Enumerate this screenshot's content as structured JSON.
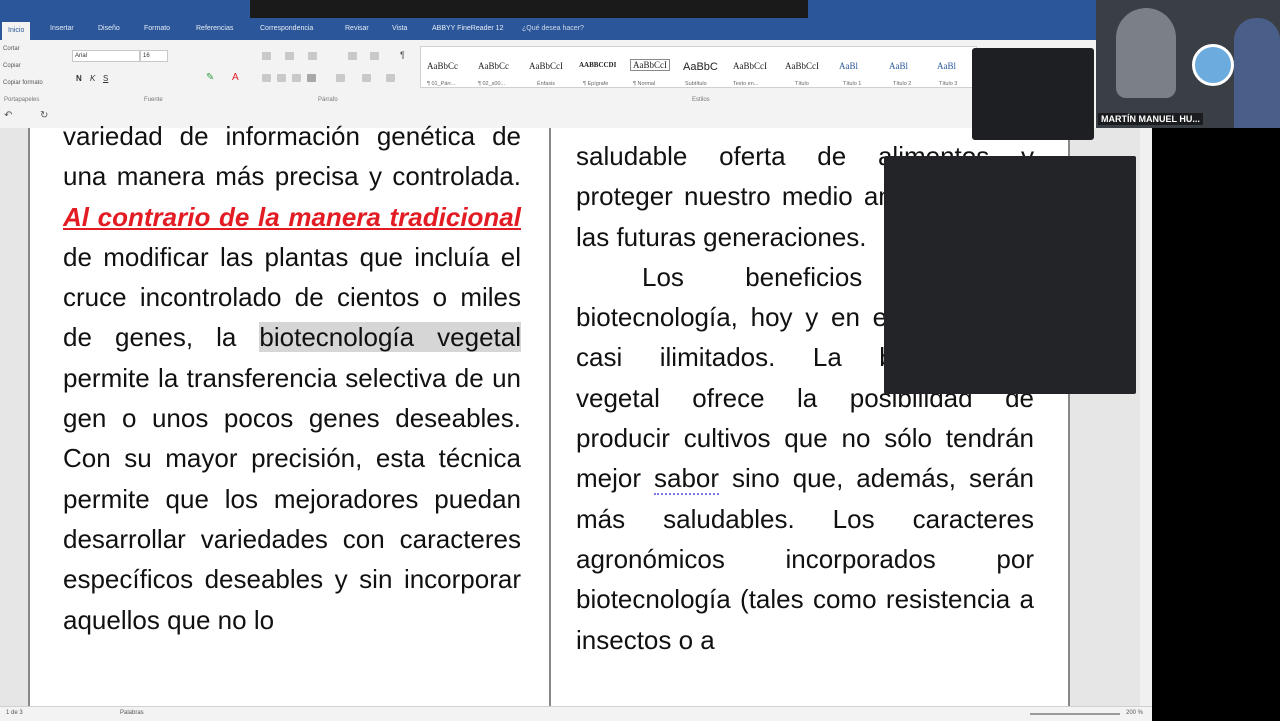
{
  "ribbon": {
    "active_tab": "Inicio",
    "tabs": [
      "Insertar",
      "Diseño",
      "Formato",
      "Referencias",
      "Correspondencia",
      "Revisar",
      "Vista",
      "ABBYY FineReader 12"
    ],
    "tell_me": "¿Qué desea hacer?",
    "clipboard": [
      "Cortar",
      "Copiar",
      "Copiar formato"
    ],
    "font_name": "Arial",
    "font_size": "16",
    "group_labels": [
      "Portapapeles",
      "Fuente",
      "Párrafo",
      "Estilos"
    ],
    "styles": [
      {
        "preview": "AaBbCc",
        "name": "¶ 01_Párr..."
      },
      {
        "preview": "AaBbCc",
        "name": "¶ 02_s00..."
      },
      {
        "preview": "AaBbCcI",
        "name": "Énfasis"
      },
      {
        "preview": "AABBCCDI",
        "name": "¶ Epígrafe"
      },
      {
        "preview": "AaBbCcI",
        "name": "¶ Normal"
      },
      {
        "preview": "AaBbC",
        "name": "Subtítulo"
      },
      {
        "preview": "AaBbCcI",
        "name": "Texto en..."
      },
      {
        "preview": "AaBbCcI",
        "name": "Título"
      },
      {
        "preview": "AaBl",
        "name": "Título 1"
      },
      {
        "preview": "AaBl",
        "name": "Título 2"
      },
      {
        "preview": "AaBl",
        "name": "Título 3"
      }
    ]
  },
  "document": {
    "left_column": {
      "p1_a": "variedad de información genética de una manera más precisa y controlada.",
      "p1_red": "Al contrario de la manera tradicional",
      "p1_b": "de modificar las plantas que incluía el cruce incontrolado de cientos o miles de genes, la",
      "p1_gray": "biotecnología vegetal",
      "p1_c": "permite la transferencia selectiva de un gen o unos pocos genes deseables. Con su mayor precisión, esta técnica permite que los mejoradores puedan desarrollar variedades con caracteres específicos deseables y sin incorporar aquellos que no lo"
    },
    "right_column": {
      "p1": "saludable oferta de alimentos y proteger nuestro medio ambiente para las futuras generaciones.",
      "p2_a": "Los beneficios de la biotecnología, hoy y en el futuro, son casi ilimitados. La biotecnología vegetal ofrece la posibilidad de producir cultivos que no sólo tendrán mejor",
      "p2_spell": "sabor",
      "p2_b": "sino que, además, serán más saludables. Los caracteres agronómicos incorporados por biotecnología (tales como resistencia a insectos o a"
    }
  },
  "webcam": {
    "name": "MARTÍN MANUEL HU..."
  },
  "status": {
    "page": "1 de 3",
    "words": "Palabras",
    "zoom": "200 %"
  }
}
